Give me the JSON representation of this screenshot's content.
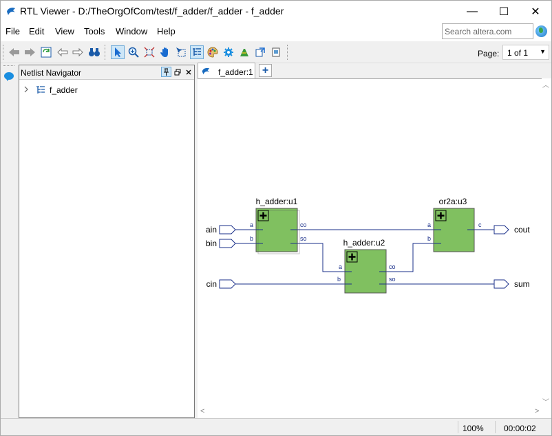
{
  "window": {
    "title": "RTL Viewer - D:/TheOrgOfCom/test/f_adder/f_adder - f_adder",
    "minimize": "—",
    "maximize": "☐",
    "close": "✕"
  },
  "menu": {
    "file": "File",
    "edit": "Edit",
    "view": "View",
    "tools": "Tools",
    "window": "Window",
    "help": "Help"
  },
  "search": {
    "placeholder": "Search altera.com"
  },
  "toolbar": {
    "page_label": "Page:",
    "page_value": "1 of 1"
  },
  "navigator": {
    "title": "Netlist Navigator",
    "tree": [
      {
        "label": "f_adder"
      }
    ]
  },
  "tab": {
    "label": "f_adder:1",
    "add": "+"
  },
  "schematic": {
    "blocks": {
      "u1": {
        "name": "h_adder:u1",
        "in_a": "a",
        "in_b": "b",
        "out_co": "co",
        "out_so": "so"
      },
      "u2": {
        "name": "h_adder:u2",
        "in_a": "a",
        "in_b": "b",
        "out_co": "co",
        "out_so": "so"
      },
      "u3": {
        "name": "or2a:u3",
        "in_a": "a",
        "in_b": "b",
        "out_c": "c"
      }
    },
    "inputs": {
      "ain": "ain",
      "bin": "bin",
      "cin": "cin"
    },
    "outputs": {
      "cout": "cout",
      "sum": "sum"
    },
    "block_color": "#80c060",
    "wire_color": "#1a2f8a"
  },
  "status": {
    "zoom": "100%",
    "time": "00:00:02"
  }
}
